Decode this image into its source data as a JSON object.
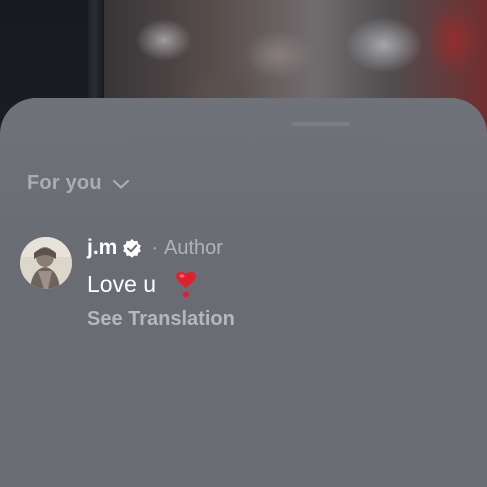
{
  "comments_sheet": {
    "filter": {
      "label": "For you",
      "icon": "chevron-down-icon"
    },
    "comment": {
      "username": "j.m",
      "verified_icon": "verified-badge-icon",
      "separator": "·",
      "role": "Author",
      "text": "Love u",
      "emoji_icon": "red-heart-exclamation-icon",
      "translate_label": "See Translation"
    }
  },
  "colors": {
    "sheet_background": "#6c7076",
    "primary_text": "#ffffff",
    "secondary_text": "#aeb3ba",
    "heart_red": "#e0202e"
  }
}
